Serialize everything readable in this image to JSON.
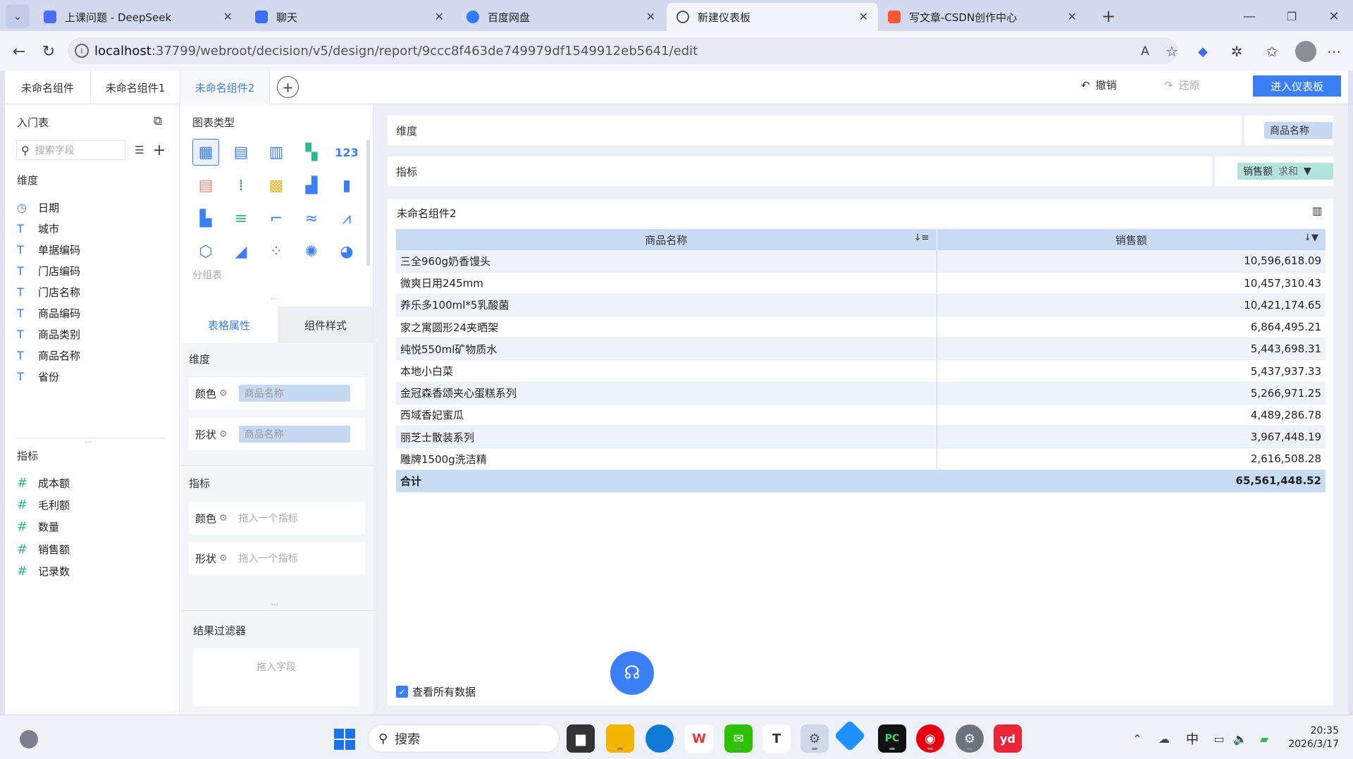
{
  "browser": {
    "tabs": [
      {
        "title": "上课问题 - DeepSeek",
        "icon": "deepseek-icon",
        "color": "#4d6bfe"
      },
      {
        "title": "聊天",
        "icon": "chat-icon",
        "color": "#3b6ef5"
      },
      {
        "title": "百度网盘",
        "icon": "baidu-pan-icon",
        "color": "#2f7cf6"
      },
      {
        "title": "新建仪表板",
        "icon": "globe-icon",
        "color": "#666666"
      },
      {
        "title": "写文章-CSDN创作中心",
        "icon": "csdn-icon",
        "color": "#fc5531"
      }
    ],
    "url_host": "localhost",
    "url_rest": ":37799/webroot/decision/v5/design/report/9ccc8f463de749979df1549912eb5641/edit"
  },
  "app": {
    "component_tabs": [
      "未命名组件",
      "未命名组件1",
      "未命名组件2"
    ],
    "undo": "撤销",
    "redo": "还原",
    "enter_dashboard": "进入仪表板",
    "accent": "#3a7ff5"
  },
  "left": {
    "table_name": "入门表",
    "search_placeholder": "搜索字段",
    "dimension_title": "维度",
    "dimensions": [
      {
        "label": "日期",
        "icon": "clock-icon"
      },
      {
        "label": "城市",
        "icon": "text-icon"
      },
      {
        "label": "单据编码",
        "icon": "text-icon"
      },
      {
        "label": "门店编码",
        "icon": "text-icon"
      },
      {
        "label": "门店名称",
        "icon": "text-icon"
      },
      {
        "label": "商品编码",
        "icon": "text-icon"
      },
      {
        "label": "商品类别",
        "icon": "text-icon"
      },
      {
        "label": "商品名称",
        "icon": "text-icon"
      },
      {
        "label": "省份",
        "icon": "text-icon"
      }
    ],
    "measure_title": "指标",
    "measures": [
      "成本额",
      "毛利额",
      "数量",
      "销售额",
      "记录数"
    ]
  },
  "middle": {
    "chart_type_title": "图表类型",
    "group_table_label": "分组表",
    "tab_table_props": "表格属性",
    "tab_component_style": "组件样式",
    "dimension_title": "维度",
    "color_label": "颜色",
    "shape_label": "形状",
    "dim_color_value": "商品名称",
    "dim_shape_value": "商品名称",
    "measure_title": "指标",
    "drop_measure": "拖入一个指标",
    "result_filter_title": "结果过滤器",
    "drop_field": "拖入字段"
  },
  "right": {
    "dimension_label": "维度",
    "dimension_value": "商品名称",
    "measure_label": "指标",
    "measure_value": "销售额",
    "measure_agg": "求和",
    "widget_title": "未命名组件2",
    "col1": "商品名称",
    "col2": "销售额",
    "rows": [
      [
        "三全960g奶香馒头",
        "10,596,618.09"
      ],
      [
        "微爽日用245mm",
        "10,457,310.43"
      ],
      [
        "养乐多100ml*5乳酸菌",
        "10,421,174.65"
      ],
      [
        "家之寓圆形24夹晒架",
        "6,864,495.21"
      ],
      [
        "纯悦550ml矿物质水",
        "5,443,698.31"
      ],
      [
        "本地小白菜",
        "5,437,937.33"
      ],
      [
        "金冠森香颂夹心蛋糕系列",
        "5,266,971.25"
      ],
      [
        "西域香妃蜜瓜",
        "4,489,286.78"
      ],
      [
        "丽芝士散装系列",
        "3,967,448.19"
      ],
      [
        "雕牌1500g洗洁精",
        "2,616,508.28"
      ]
    ],
    "total_label": "合计",
    "total_value": "65,561,448.52",
    "view_all": "查看所有数据"
  },
  "taskbar": {
    "search_placeholder": "搜索",
    "ime": "中",
    "time": "20:35",
    "date": "2026/3/17"
  }
}
